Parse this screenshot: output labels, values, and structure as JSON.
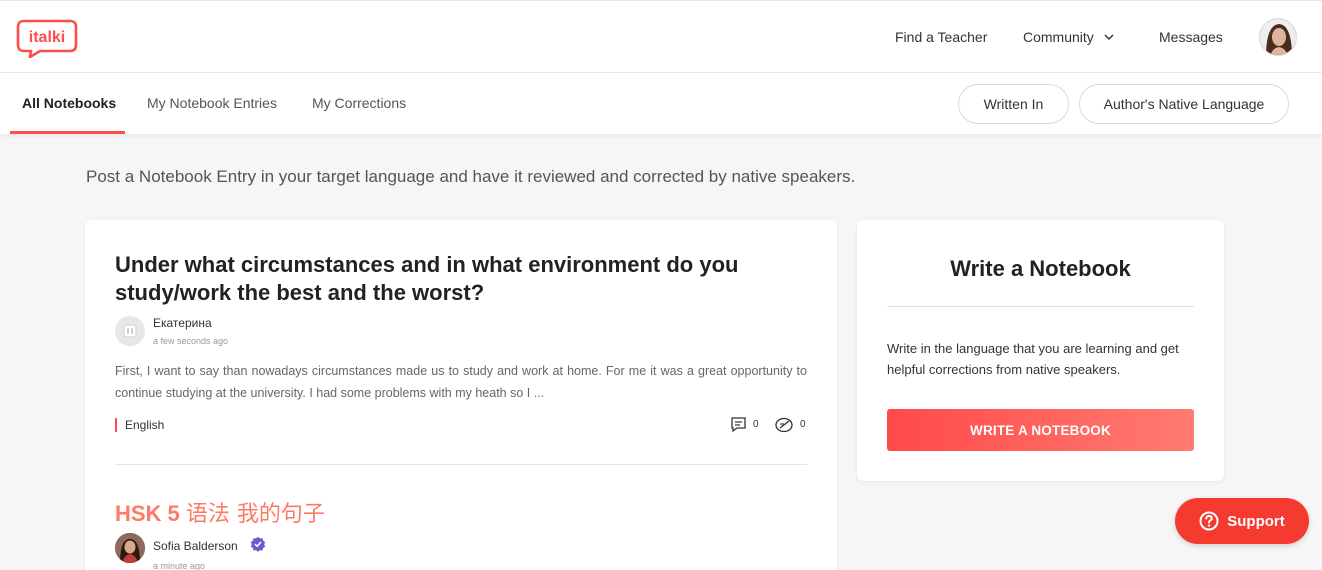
{
  "header": {
    "logo_text": "italki",
    "nav": {
      "find_teacher": "Find a Teacher",
      "community": "Community",
      "messages": "Messages"
    }
  },
  "subnav": {
    "tabs": [
      {
        "label": "All Notebooks",
        "active": true
      },
      {
        "label": "My Notebook Entries",
        "active": false
      },
      {
        "label": "My Corrections",
        "active": false
      }
    ],
    "filters": {
      "written_in": "Written In",
      "native_language": "Author's Native Language"
    }
  },
  "intro": "Post a Notebook Entry in your target language and have it reviewed and corrected by native speakers.",
  "entries": [
    {
      "title": "Under what circumstances and in what environment do you study/work the best and the worst?",
      "author": "Екатерина",
      "time": "a few seconds ago",
      "excerpt": "First, I want to say than nowadays circumstances made us to study and work at home. For me it was a great opportunity to continue studying at the university. I had some problems with my heath so I ...",
      "language": "English",
      "comments": "0",
      "corrections": "0"
    },
    {
      "title_latin": "HSK 5",
      "title_cn": "语法 我的句子",
      "author": "Sofia Balderson",
      "time": "a minute ago"
    }
  ],
  "sidebar": {
    "title": "Write a Notebook",
    "text": "Write in the language that you are learning and get helpful corrections from native speakers.",
    "button": "WRITE A NOTEBOOK"
  },
  "support": {
    "label": "Support"
  },
  "colors": {
    "brand": "#ff4d4d",
    "accent_title": "#ff7a66",
    "support": "#f53b30"
  }
}
